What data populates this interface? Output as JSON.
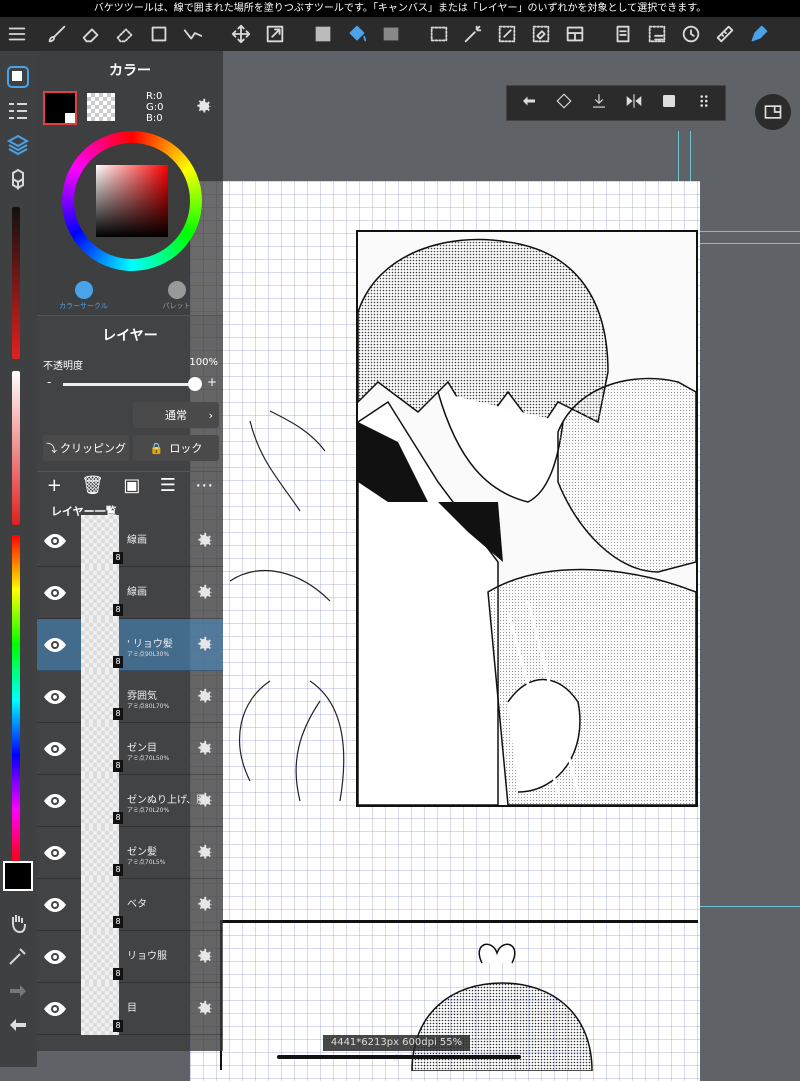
{
  "status_bar": {
    "message": "バケツツールは、線で囲まれた場所を塗りつぶすツールです。「キャンバス」または「レイヤー」のいずれかを対象として選択できます。"
  },
  "toolbar": {
    "icons": [
      "menu-icon",
      "brush-icon",
      "eraser-icon",
      "blur-icon",
      "rect-shape-icon",
      "polyline-icon",
      "move-icon",
      "transform-icon",
      "fill-color-icon",
      "bucket-icon",
      "gradient-icon",
      "select-rect-icon",
      "magic-wand-icon",
      "select-pen-icon",
      "select-eraser-icon",
      "layout-icon",
      "copy-icon",
      "deselect-icon",
      "rotate-icon",
      "ruler-icon",
      "pen-mode-icon"
    ]
  },
  "color_panel": {
    "title": "カラー",
    "rgb": {
      "r": "R:0",
      "g": "G:0",
      "b": "B:0"
    },
    "tabs": [
      "カラーサークル",
      "パレット"
    ],
    "primary_color": "#000000"
  },
  "layer_panel": {
    "title": "レイヤー",
    "opacity_label": "不透明度",
    "opacity_value": "100%",
    "opacity": 1.0,
    "minus": "-",
    "plus": "+",
    "blend_mode": "通常",
    "clipping": "クリッピング",
    "lock": "ロック",
    "list_title": "レイヤー一覧",
    "layers": [
      {
        "name": "線画",
        "sub": "",
        "selected": false
      },
      {
        "name": "線画",
        "sub": "",
        "selected": false
      },
      {
        "name": "' リョウ髪",
        "sub": "アミ点90L30%",
        "selected": true
      },
      {
        "name": "雰囲気",
        "sub": "アミ点80L70%",
        "selected": false
      },
      {
        "name": "ゼン目",
        "sub": "アミ点70L50%",
        "selected": false
      },
      {
        "name": "ゼンぬり上げ、服",
        "sub": "アミ点70L20%",
        "selected": false
      },
      {
        "name": "ゼン髪",
        "sub": "アミ点70L5%",
        "selected": false
      },
      {
        "name": "ベタ",
        "sub": "",
        "selected": false
      },
      {
        "name": "リョウ服",
        "sub": "",
        "selected": false
      },
      {
        "name": "目",
        "sub": "",
        "selected": false
      }
    ],
    "badge": "8"
  },
  "canvas": {
    "info": "4441*6213px 600dpi 55% -6°"
  },
  "colors": {
    "accent": "#5b9bd5",
    "toolbar_bg": "#2b2b2b",
    "canvas_bg": "#5f6368"
  }
}
